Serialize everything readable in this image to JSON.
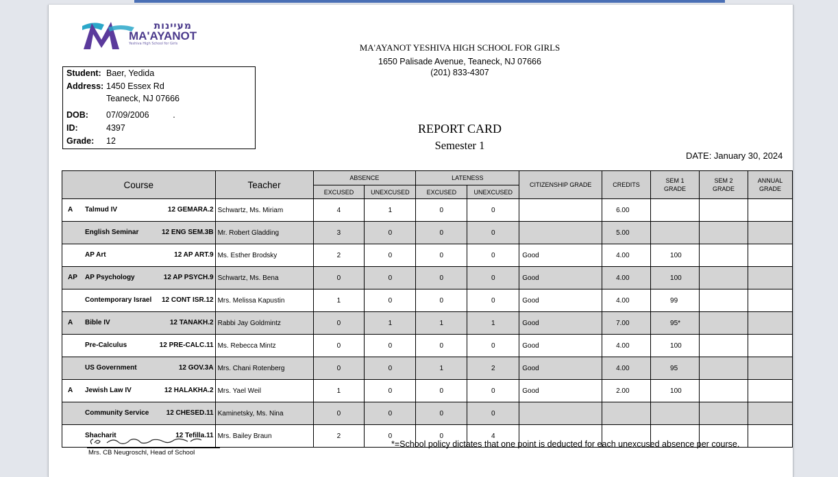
{
  "logo": {
    "hebrew": "מעיינות",
    "name": "MA'AYANOT",
    "tagline": "Yeshiva High School for Girls"
  },
  "student": {
    "rows": [
      {
        "label": "Student:",
        "value": "Baer, Yedida"
      },
      {
        "label": "Address:",
        "value": "1450 Essex Rd"
      },
      {
        "label": "",
        "value": "Teaneck, NJ 07666"
      },
      {
        "label": "DOB:",
        "value": "07/09/2006          ."
      },
      {
        "label": "ID:",
        "value": "4397"
      },
      {
        "label": "Grade:",
        "value": "12"
      }
    ]
  },
  "school": {
    "name": "MA'AYANOT YESHIVA HIGH SCHOOL FOR GIRLS",
    "address": "1650 Palisade Avenue, Teaneck, NJ 07666",
    "phone": "(201) 833-4307"
  },
  "report": {
    "title": "REPORT CARD",
    "semester": "Semester 1",
    "date": "DATE: January 30, 2024"
  },
  "table": {
    "headers": {
      "course": "Course",
      "teacher": "Teacher",
      "absence": "ABSENCE",
      "lateness": "LATENESS",
      "excused": "EXCUSED",
      "unexcused": "UNEXCUSED",
      "citizenship": "CITIZENSHIP GRADE",
      "credits": "CREDITS",
      "sem1": "SEM 1 GRADE",
      "sem2": "SEM 2 GRADE",
      "annual": "ANNUAL GRADE"
    },
    "rows": [
      {
        "prefix": "A",
        "name": "Talmud IV",
        "code": "12 GEMARA.2",
        "teacher": "Schwartz, Ms. Miriam",
        "abs_exc": "4",
        "abs_unexc": "1",
        "late_exc": "0",
        "late_unexc": "0",
        "citizenship": "",
        "credits": "6.00",
        "sem1": "",
        "sem2": "",
        "annual": ""
      },
      {
        "prefix": "",
        "name": "English Seminar",
        "code": "12 ENG SEM.3B",
        "teacher": "Mr. Robert Gladding",
        "abs_exc": "3",
        "abs_unexc": "0",
        "late_exc": "0",
        "late_unexc": "0",
        "citizenship": "",
        "credits": "5.00",
        "sem1": "",
        "sem2": "",
        "annual": ""
      },
      {
        "prefix": "",
        "name": "AP Art",
        "code": "12 AP ART.9",
        "teacher": "Ms. Esther Brodsky",
        "abs_exc": "2",
        "abs_unexc": "0",
        "late_exc": "0",
        "late_unexc": "0",
        "citizenship": "Good",
        "credits": "4.00",
        "sem1": "100",
        "sem2": "",
        "annual": ""
      },
      {
        "prefix": "AP",
        "name": "AP Psychology",
        "code": "12 AP PSYCH.9",
        "teacher": "Schwartz, Ms. Bena",
        "abs_exc": "0",
        "abs_unexc": "0",
        "late_exc": "0",
        "late_unexc": "0",
        "citizenship": "Good",
        "credits": "4.00",
        "sem1": "100",
        "sem2": "",
        "annual": ""
      },
      {
        "prefix": "",
        "name": "Contemporary Israel",
        "code": "12 CONT ISR.12",
        "teacher": "Mrs. Melissa Kapustin",
        "abs_exc": "1",
        "abs_unexc": "0",
        "late_exc": "0",
        "late_unexc": "0",
        "citizenship": "Good",
        "credits": "4.00",
        "sem1": "99",
        "sem2": "",
        "annual": ""
      },
      {
        "prefix": "A",
        "name": "Bible IV",
        "code": "12 TANAKH.2",
        "teacher": "Rabbi Jay Goldmintz",
        "abs_exc": "0",
        "abs_unexc": "1",
        "late_exc": "1",
        "late_unexc": "1",
        "citizenship": "Good",
        "credits": "7.00",
        "sem1": "95*",
        "sem2": "",
        "annual": ""
      },
      {
        "prefix": "",
        "name": "Pre-Calculus",
        "code": "12 PRE-CALC.11",
        "teacher": "Ms. Rebecca Mintz",
        "abs_exc": "0",
        "abs_unexc": "0",
        "late_exc": "0",
        "late_unexc": "0",
        "citizenship": "Good",
        "credits": "4.00",
        "sem1": "100",
        "sem2": "",
        "annual": ""
      },
      {
        "prefix": "",
        "name": "US Government",
        "code": "12 GOV.3A",
        "teacher": "Mrs. Chani Rotenberg",
        "abs_exc": "0",
        "abs_unexc": "0",
        "late_exc": "1",
        "late_unexc": "2",
        "citizenship": "Good",
        "credits": "4.00",
        "sem1": "95",
        "sem2": "",
        "annual": ""
      },
      {
        "prefix": "A",
        "name": "Jewish Law IV",
        "code": "12 HALAKHA.2",
        "teacher": "Mrs. Yael Weil",
        "abs_exc": "1",
        "abs_unexc": "0",
        "late_exc": "0",
        "late_unexc": "0",
        "citizenship": "Good",
        "credits": "2.00",
        "sem1": "100",
        "sem2": "",
        "annual": ""
      },
      {
        "prefix": "",
        "name": "Community Service",
        "code": "12 CHESED.11",
        "teacher": "Kaminetsky, Ms. Nina",
        "abs_exc": "0",
        "abs_unexc": "0",
        "late_exc": "0",
        "late_unexc": "0",
        "citizenship": "",
        "credits": "",
        "sem1": "",
        "sem2": "",
        "annual": ""
      },
      {
        "prefix": "",
        "name": "Shacharit",
        "code": "12 Tefilla.11",
        "teacher": "Mrs. Bailey Braun",
        "abs_exc": "2",
        "abs_unexc": "0",
        "late_exc": "0",
        "late_unexc": "4",
        "citizenship": "",
        "credits": "",
        "sem1": "",
        "sem2": "",
        "annual": ""
      }
    ]
  },
  "signature": {
    "script": "CB Neugroschl",
    "label": "Mrs. CB Neugroschl, Head of School"
  },
  "footnote": "*=School policy dictates that one point is deducted for each unexcused absence per course."
}
